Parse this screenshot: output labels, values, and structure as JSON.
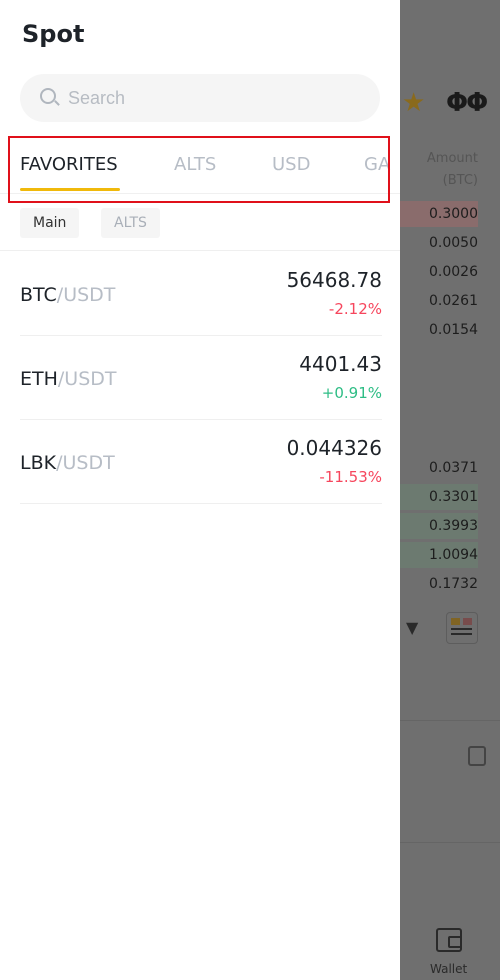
{
  "drawer": {
    "title": "Spot",
    "search_placeholder": "Search",
    "tabs": [
      "FAVORITES",
      "ALTS",
      "USD",
      "GA"
    ],
    "active_tab": "FAVORITES",
    "filters": [
      "Main",
      "ALTS"
    ],
    "pairs": [
      {
        "base": "BTC",
        "quote": "/USDT",
        "price": "56468.78",
        "change": "-2.12%",
        "direction": "down"
      },
      {
        "base": "ETH",
        "quote": "/USDT",
        "price": "4401.43",
        "change": "+0.91%",
        "direction": "up"
      },
      {
        "base": "LBK",
        "quote": "/USDT",
        "price": "0.044326",
        "change": "-11.53%",
        "direction": "down"
      }
    ]
  },
  "background": {
    "amount_header": "Amount",
    "amount_unit": "(BTC)",
    "asks": [
      "0.3000",
      "0.0050",
      "0.0026",
      "0.0261",
      "0.0154"
    ],
    "bids": [
      "0.0371",
      "0.3301",
      "0.3993",
      "1.0094",
      "0.1732"
    ],
    "wallet_label": "Wallet"
  },
  "colors": {
    "accent": "#f0b90b",
    "down": "#f6465d",
    "up": "#2ebd85",
    "highlight": "#e0101a"
  }
}
